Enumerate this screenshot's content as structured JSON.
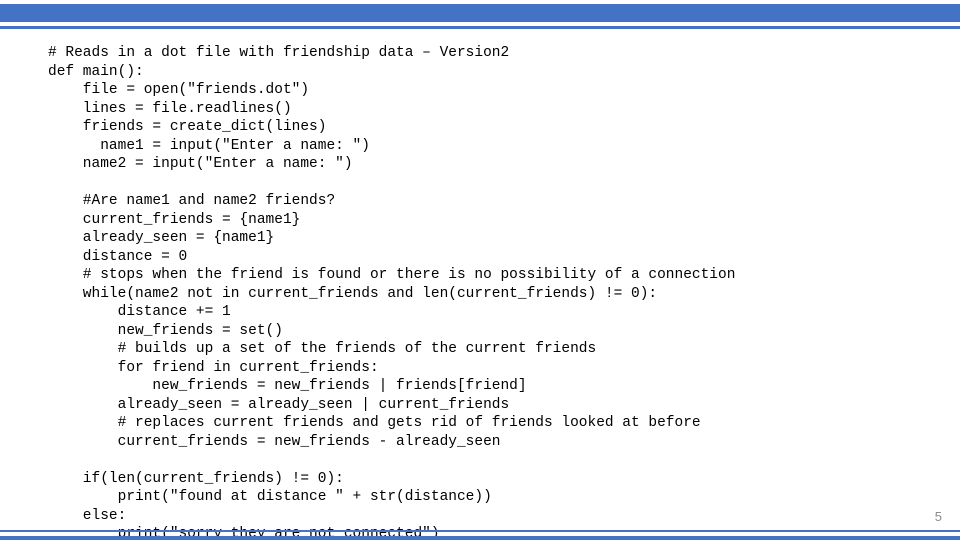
{
  "slide": {
    "page_number": "5",
    "code_lines": [
      "# Reads in a dot file with friendship data – Version2",
      "def main():",
      "    file = open(\"friends.dot\")",
      "    lines = file.readlines()",
      "    friends = create_dict(lines)",
      "      name1 = input(\"Enter a name: \")",
      "    name2 = input(\"Enter a name: \")",
      "",
      "    #Are name1 and name2 friends?",
      "    current_friends = {name1}",
      "    already_seen = {name1}",
      "    distance = 0",
      "    # stops when the friend is found or there is no possibility of a connection",
      "    while(name2 not in current_friends and len(current_friends) != 0):",
      "        distance += 1",
      "        new_friends = set()",
      "        # builds up a set of the friends of the current friends",
      "        for friend in current_friends:",
      "            new_friends = new_friends | friends[friend]",
      "        already_seen = already_seen | current_friends",
      "        # replaces current friends and gets rid of friends looked at before",
      "        current_friends = new_friends - already_seen",
      "",
      "    if(len(current_friends) != 0):",
      "        print(\"found at distance \" + str(distance))",
      "    else:",
      "        print(\"sorry they are not connected\")"
    ]
  }
}
